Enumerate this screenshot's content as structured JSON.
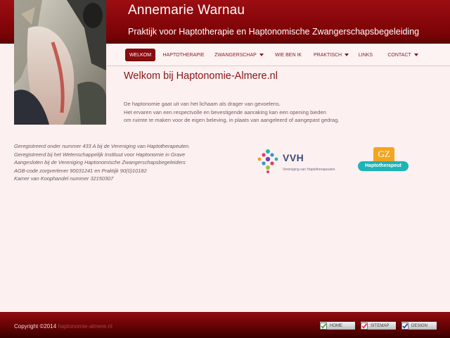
{
  "header": {
    "name": "Annemarie Warnau",
    "tagline": "Praktijk voor Haptotherapie en Haptonomische Zwangerschapsbegeleiding"
  },
  "nav": {
    "items": [
      {
        "label": "WELKOM",
        "active": true,
        "dropdown": false
      },
      {
        "label": "HAPTOTHERAPIE",
        "active": false,
        "dropdown": false
      },
      {
        "label": "ZWANGERSCHAP",
        "active": false,
        "dropdown": true
      },
      {
        "label": "WIE BEN IK",
        "active": false,
        "dropdown": false
      },
      {
        "label": "PRAKTISCH",
        "active": false,
        "dropdown": true
      },
      {
        "label": "LINKS",
        "active": false,
        "dropdown": false
      },
      {
        "label": "CONTACT",
        "active": false,
        "dropdown": true
      }
    ]
  },
  "main": {
    "title": "Welkom bij Haptonomie-Almere.nl",
    "intro": [
      "De haptonomie gaat uit van het lichaam als drager van gevoelens.",
      "Het ervaren van een respectvolle en bevestigende aanraking kan een opening bieden",
      "om ruimte te maken voor de eigen beleving, in plaats van aangeleerd of aangepast gedrag."
    ]
  },
  "registry": {
    "lines": [
      "Geregistreerd onder nummer 433 A bij de Vereniging van Haptotherapeuten.",
      "Geregistreerd bij het Wetenschappelijk Instituut voor Haptonomie in Grave",
      "Aangesloten bij de Vereniging Haptonomische Zwangerschapsbegeleiders",
      "AGB-code zorgverlener 90031241  en Praktijk 90(0)10182",
      "Kamer van Koophandel nummer 32150307"
    ]
  },
  "logos": {
    "vvh": {
      "wordmark": "VVH",
      "subtitle": "Vereniging van Haptotherapeuten"
    },
    "gz": {
      "mark": "GZ",
      "label": "Haptotherapeut"
    }
  },
  "footer": {
    "copyright": "Copyright ©2014",
    "copyright_muted": " haptonomie-almere.nl",
    "buttons": [
      {
        "label": "HOME",
        "check_color": "#3cae2b"
      },
      {
        "label": "SITEMAP",
        "check_color": "#d8344c"
      },
      {
        "label": "DESIGN",
        "check_color": "#2b3ca8"
      }
    ]
  },
  "colors": {
    "brand_red": "#8a0c10",
    "page_bg": "#fdf0f0",
    "title_red": "#8a1414",
    "vvh_blue": "#3d4a7e",
    "gz_orange": "#f2a51e",
    "gz_teal": "#1eb3b4"
  }
}
